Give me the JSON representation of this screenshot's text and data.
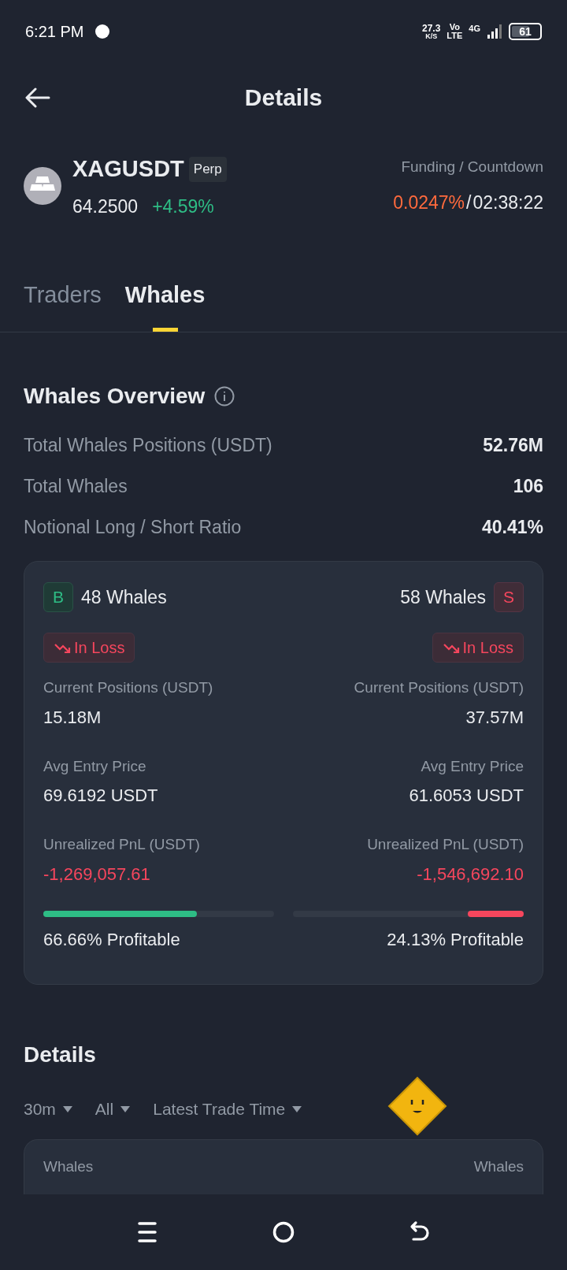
{
  "status_bar": {
    "time": "6:21 PM",
    "net_speed": "27.3",
    "net_unit": "K/S",
    "volte_top": "Vo",
    "volte_bottom": "LTE",
    "network": "4G",
    "battery": "61"
  },
  "header": {
    "title": "Details"
  },
  "instrument": {
    "symbol": "XAGUSDT",
    "tag": "Perp",
    "price": "64.2500",
    "change": "+4.59%",
    "funding_label": "Funding / Countdown",
    "funding_rate": "0.0247%",
    "separator": "/",
    "countdown": "02:38:22"
  },
  "tabs": [
    {
      "label": "Traders",
      "selected": false
    },
    {
      "label": "Whales",
      "selected": true
    }
  ],
  "overview": {
    "title": "Whales Overview",
    "rows": [
      {
        "label": "Total Whales Positions (USDT)",
        "value": "52.76M"
      },
      {
        "label": "Total Whales",
        "value": "106"
      },
      {
        "label": "Notional Long / Short Ratio",
        "value": "40.41%"
      }
    ]
  },
  "sides": [
    {
      "kind": "long",
      "badge": "B",
      "whales": "48 Whales",
      "status": "In Loss",
      "positions_label": "Current Positions (USDT)",
      "positions": "15.18M",
      "entry_label": "Avg Entry Price",
      "entry": "69.6192 USDT",
      "pnl_label": "Unrealized PnL (USDT)",
      "pnl": "-1,269,057.61",
      "level": 0.6666,
      "profitable": "66.66% Profitable"
    },
    {
      "kind": "short",
      "badge": "S",
      "whales": "58 Whales",
      "status": "In Loss",
      "positions_label": "Current Positions (USDT)",
      "positions": "37.57M",
      "entry_label": "Avg Entry Price",
      "entry": "61.6053 USDT",
      "pnl_label": "Unrealized PnL (USDT)",
      "pnl": "-1,546,692.10",
      "level": 0.2413,
      "profitable": "24.13% Profitable"
    }
  ],
  "details": {
    "title": "Details",
    "filters": [
      {
        "label": "30m"
      },
      {
        "label": "All"
      },
      {
        "label": "Latest Trade Time"
      }
    ],
    "columns": [
      "Whales",
      "Whales"
    ]
  }
}
